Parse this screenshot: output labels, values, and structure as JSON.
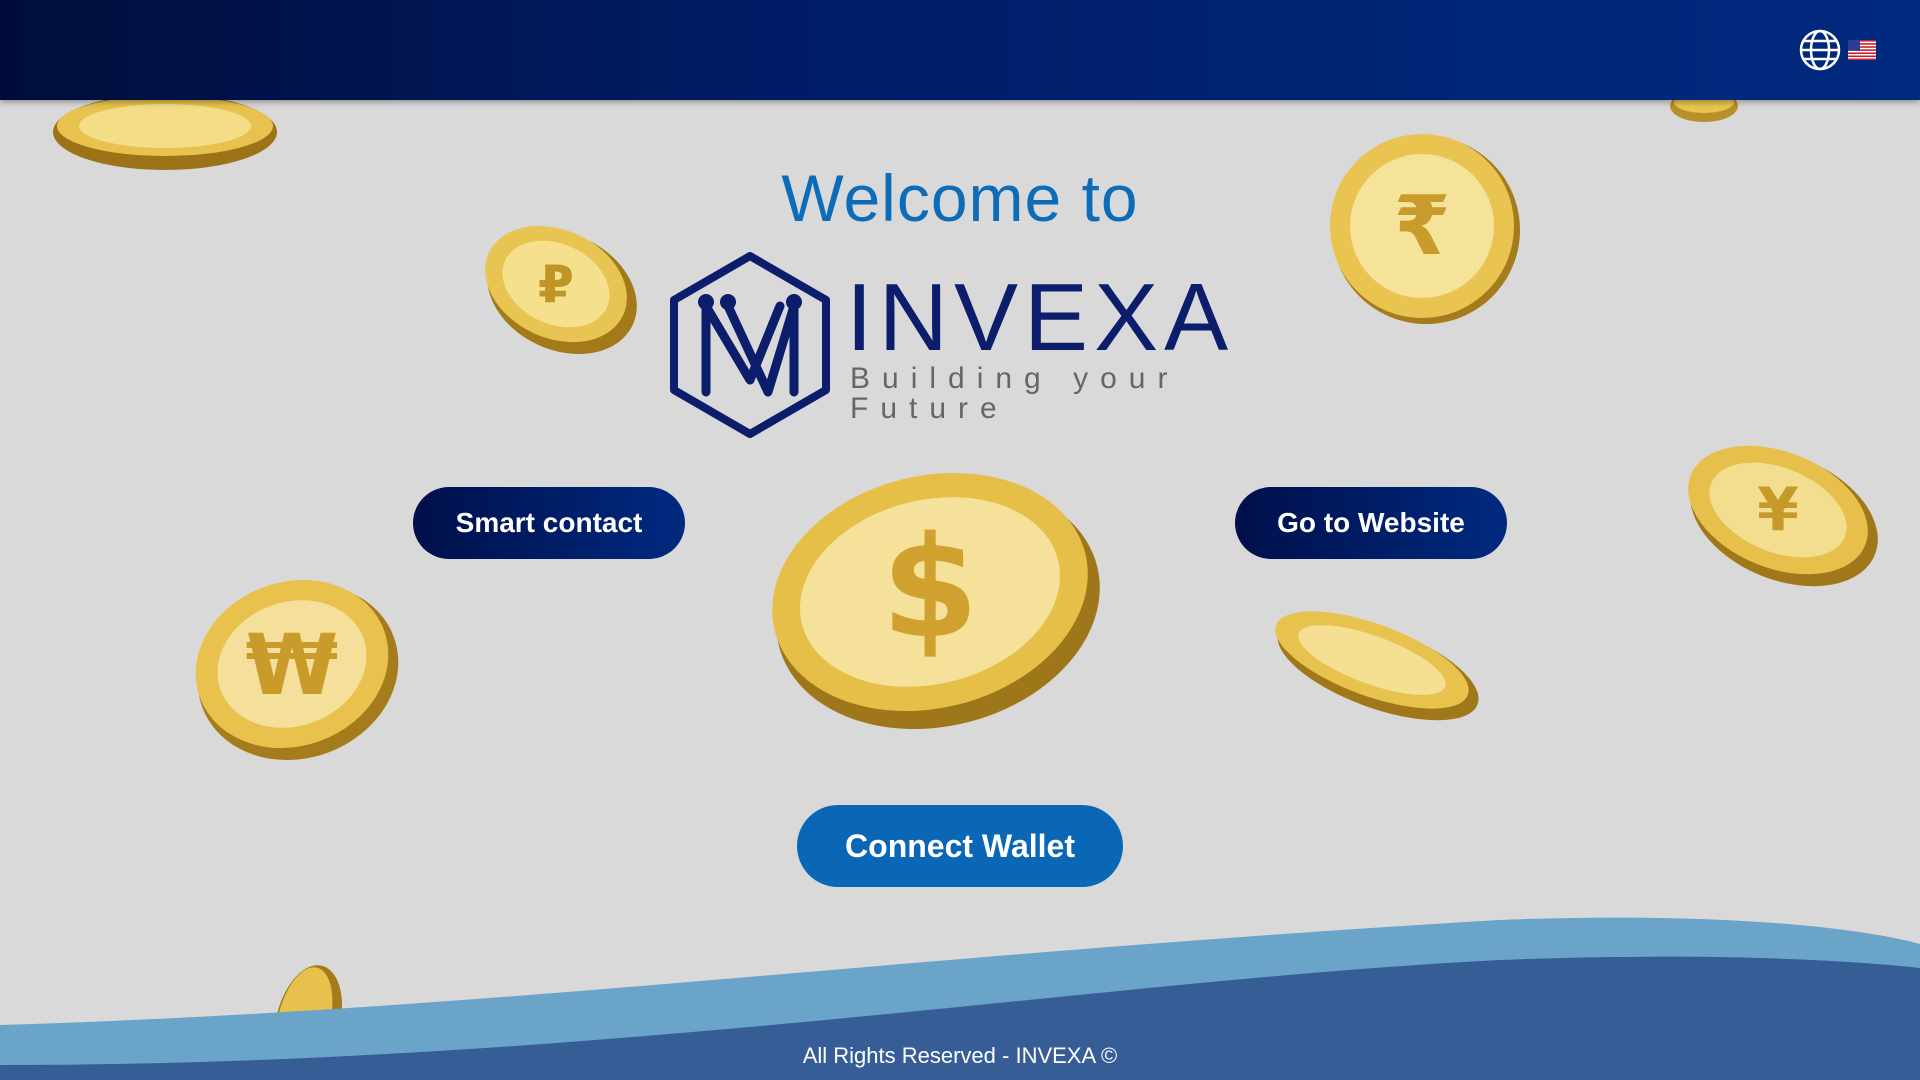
{
  "header": {
    "language_icon": "globe-icon",
    "current_language_flag": "us-flag-icon"
  },
  "welcome_text": "Welcome to",
  "logo": {
    "wordmark": "INVEXA",
    "tagline": "Building your Future",
    "mark_letters": "NV"
  },
  "buttons": {
    "smart_contact": "Smart contact",
    "go_to_website": "Go to Website",
    "connect_wallet": "Connect Wallet"
  },
  "decor": {
    "coin_symbols": [
      "$",
      "₽",
      "₩",
      "₹",
      "€",
      "¥"
    ]
  },
  "footer": {
    "copyright": "All Rights Reserved - INVEXA ©"
  },
  "colors": {
    "header_start": "#000d3a",
    "header_end": "#002a80",
    "accent_blue": "#0a67b6",
    "page_bg": "#d9d9d9",
    "wave_light": "#6aa4c8",
    "wave_dark": "#375d96"
  }
}
